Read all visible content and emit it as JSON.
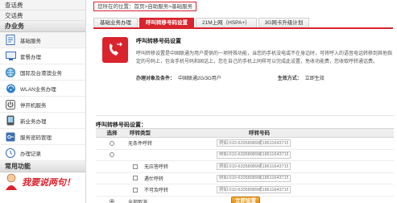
{
  "sidebar": {
    "top_links": [
      "查话费",
      "交话费"
    ],
    "group1": "办业务",
    "items": [
      {
        "label": "基础服务",
        "icon": "document-icon",
        "active": true
      },
      {
        "label": "套餐办理",
        "icon": "monitor-icon",
        "active": false
      },
      {
        "label": "国际及台港澳业务",
        "icon": "globe-icon",
        "active": false
      },
      {
        "label": "WLAN业务办理",
        "icon": "wlan-icon",
        "active": false
      },
      {
        "label": "停开机服务",
        "icon": "power-icon",
        "active": false
      },
      {
        "label": "新业务办理",
        "icon": "phone-icon",
        "active": false
      },
      {
        "label": "服务密码管理",
        "icon": "key-icon",
        "active": false
      },
      {
        "label": "办理记录",
        "icon": "history-icon",
        "active": false
      }
    ],
    "group2": "常用功能",
    "promo": "我要说两句！"
  },
  "breadcrumb": {
    "prefix": "您所在的位置：",
    "items": [
      "首页",
      "自助服务",
      "基础服务"
    ],
    "sep": ">"
  },
  "tabs": [
    {
      "label": "基础业务办理",
      "active": false
    },
    {
      "label": "呼叫转移号码设置",
      "active": true
    },
    {
      "label": "21M上网（HSPA+）",
      "active": false
    },
    {
      "label": "3G网卡升级计划",
      "active": false
    }
  ],
  "info": {
    "title": "呼叫转移号码设置",
    "desc": "呼叫转移设置是中国联通为用户提供的一项特殊功能，当您的手机没电或不在身边时，可将呼入的语音电话转移到其他指定的号码上，包含手机号码和固话上，您在自己的手机上同样可以完成此设置，免收功能费，您收取呼转通话费。",
    "cond_label": "办理对象及条件：",
    "cond_value": "中国联通2G/3G用户",
    "eff_label": "生效方式：",
    "eff_value": "立即生效"
  },
  "form": {
    "section_title": "呼叫转移号码设置：",
    "headers": {
      "select": "选择",
      "type": "呼转类型",
      "number": "呼转号码"
    },
    "rows": [
      {
        "type": "无条件呼转",
        "kind": "radio",
        "indent": false,
        "checked": false,
        "placeholder": "例如:010-63358989或18611643715"
      },
      {
        "type": "",
        "kind": "radio",
        "indent": false,
        "checked": false,
        "placeholder": "例如:010-63358989或18611643715"
      },
      {
        "type": "无应答呼转",
        "kind": "checkbox",
        "indent": true,
        "checked": false,
        "placeholder": "例如:010-63358989或18611643715"
      },
      {
        "type": "遇忙呼转",
        "kind": "checkbox",
        "indent": true,
        "checked": false,
        "placeholder": "例如:010-63358989或18611643715"
      },
      {
        "type": "不可及呼转",
        "kind": "checkbox",
        "indent": true,
        "checked": false,
        "placeholder": "例如:010-63358989或18611643715"
      },
      {
        "type": "全部取消",
        "kind": "radio",
        "indent": false,
        "checked": true,
        "placeholder": ""
      }
    ],
    "submit": "立即设置"
  },
  "colors": {
    "accent": "#d9232d",
    "submit": "#f0a020"
  }
}
